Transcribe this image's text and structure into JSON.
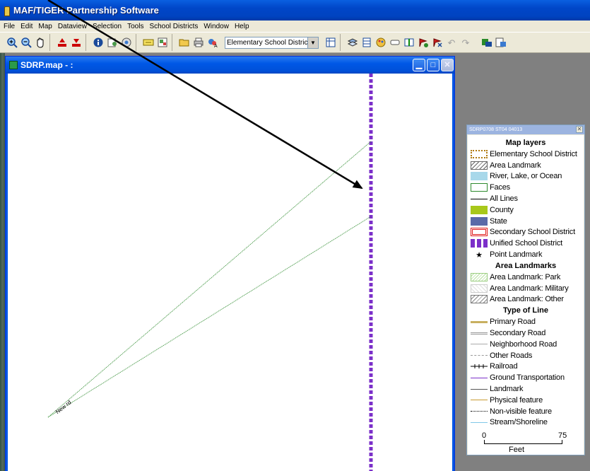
{
  "app": {
    "title": "MAF/TIGER Partnership Software"
  },
  "menu": [
    "File",
    "Edit",
    "Map",
    "Dataview",
    "Selection",
    "Tools",
    "School Districts",
    "Window",
    "Help"
  ],
  "toolbar": {
    "layer_select_value": "Elementary School District"
  },
  "map_window": {
    "title": "SDRP.map - :",
    "road_label": "New rd"
  },
  "legend": {
    "window_title": "SDRP0708 ST04 04013",
    "headings": {
      "map_layers": "Map layers",
      "area_landmarks": "Area Landmarks",
      "type_of_line": "Type of Line"
    },
    "map_layers": [
      {
        "label": "Elementary School District"
      },
      {
        "label": "Area Landmark"
      },
      {
        "label": "River, Lake, or Ocean"
      },
      {
        "label": "Faces"
      },
      {
        "label": "All Lines"
      },
      {
        "label": "County"
      },
      {
        "label": "State"
      },
      {
        "label": "Secondary School District"
      },
      {
        "label": "Unified School District"
      },
      {
        "label": "Point Landmark"
      }
    ],
    "area_landmarks": [
      {
        "label": "Area Landmark: Park"
      },
      {
        "label": "Area Landmark: Military"
      },
      {
        "label": "Area Landmark: Other"
      }
    ],
    "line_types": [
      {
        "label": "Primary Road"
      },
      {
        "label": "Secondary Road"
      },
      {
        "label": "Neighborhood Road"
      },
      {
        "label": "Other Roads"
      },
      {
        "label": "Railroad"
      },
      {
        "label": "Ground Transportation"
      },
      {
        "label": "Landmark"
      },
      {
        "label": "Physical feature"
      },
      {
        "label": "Non-visible feature"
      },
      {
        "label": "Stream/Shoreline"
      }
    ],
    "scale": {
      "min": "0",
      "max": "75",
      "unit": "Feet"
    }
  },
  "colors": {
    "title_bar": "#0046c8",
    "unified_district": "#7b2fc9",
    "road_line": "#2e8b2e"
  }
}
